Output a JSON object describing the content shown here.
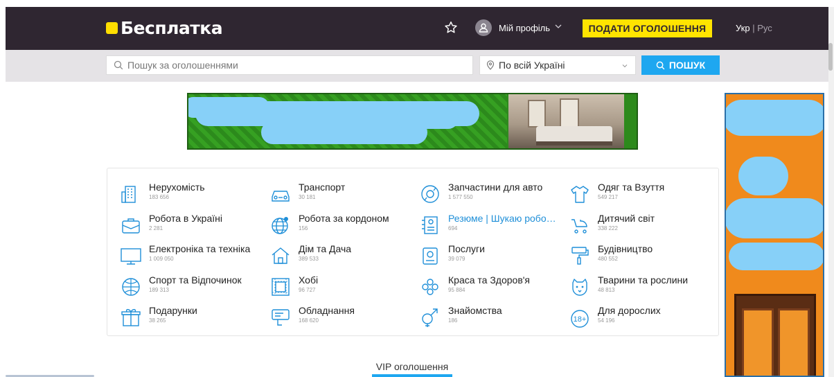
{
  "header": {
    "logo_text": "Бесплатка",
    "profile_label": "Мій профіль",
    "post_ad_label": "ПОДАТИ ОГОЛОШЕННЯ",
    "lang_ukr": "Укр",
    "lang_sep": "|",
    "lang_rus": "Рус"
  },
  "search": {
    "placeholder": "Пошук за оголошеннями",
    "value": "",
    "location_value": "По всій Україні",
    "button_label": "ПОШУК"
  },
  "categories": [
    {
      "name": "Нерухомість",
      "count": "183 656",
      "icon": "building-icon"
    },
    {
      "name": "Транспорт",
      "count": "30 181",
      "icon": "car-icon"
    },
    {
      "name": "Запчастини для авто",
      "count": "1 577 550",
      "icon": "parts-icon"
    },
    {
      "name": "Одяг та Взуття",
      "count": "549 217",
      "icon": "shirt-icon"
    },
    {
      "name": "Робота в Україні",
      "count": "2 281",
      "icon": "briefcase-icon"
    },
    {
      "name": "Робота за кордоном",
      "count": "156",
      "icon": "globe-icon"
    },
    {
      "name": "Резюме | Шукаю робо…",
      "count": "694",
      "icon": "resume-icon"
    },
    {
      "name": "Дитячий світ",
      "count": "338 222",
      "icon": "stroller-icon"
    },
    {
      "name": "Електроніка та техніка",
      "count": "1 009 050",
      "icon": "monitor-icon"
    },
    {
      "name": "Дім та Дача",
      "count": "389 533",
      "icon": "house-icon"
    },
    {
      "name": "Послуги",
      "count": "39 079",
      "icon": "services-icon"
    },
    {
      "name": "Будівництво",
      "count": "480 552",
      "icon": "paint-roller-icon"
    },
    {
      "name": "Спорт та Відпочинок",
      "count": "189 313",
      "icon": "ball-icon"
    },
    {
      "name": "Хобі",
      "count": "96 727",
      "icon": "hobby-icon"
    },
    {
      "name": "Краса та Здоров'я",
      "count": "95 884",
      "icon": "beauty-icon"
    },
    {
      "name": "Тварини та рослини",
      "count": "48 813",
      "icon": "pet-icon"
    },
    {
      "name": "Подарунки",
      "count": "38 265",
      "icon": "gift-icon"
    },
    {
      "name": "Обладнання",
      "count": "168 620",
      "icon": "equipment-icon"
    },
    {
      "name": "Знайомства",
      "count": "186",
      "icon": "dating-icon"
    },
    {
      "name": "Для дорослих",
      "count": "54 196",
      "icon": "adult-18-icon"
    }
  ],
  "vip": {
    "title": "VIP оголошення"
  },
  "colors": {
    "header_bg": "#2f2631",
    "accent_yellow": "#ffe400",
    "accent_blue": "#1ea7f0",
    "icon_blue": "#1f8fd8"
  }
}
